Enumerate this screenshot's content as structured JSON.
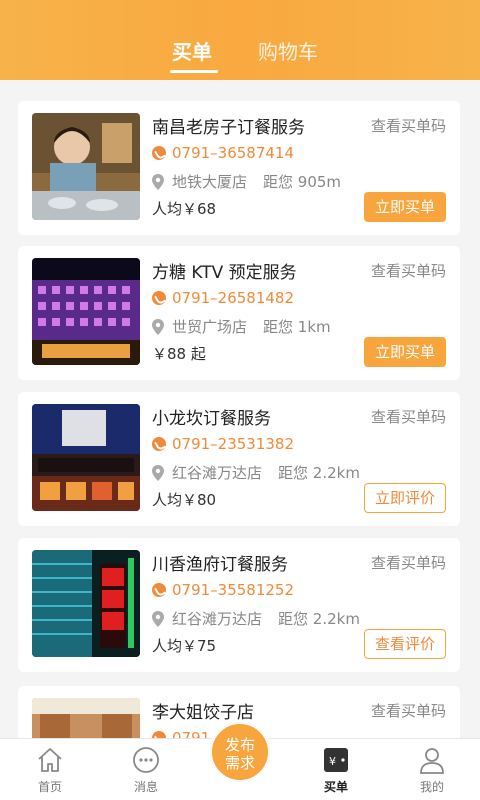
{
  "header": {
    "tabs": [
      {
        "label": "买单",
        "active": true
      },
      {
        "label": "购物车",
        "active": false
      }
    ]
  },
  "orders": [
    {
      "title": "南昌老房子订餐服务",
      "code_link": "查看买单码",
      "phone": "0791–36587414",
      "location": "地铁大厦店",
      "distance": "距您 905m",
      "price": "人均￥68",
      "action": "立即买单",
      "action_style": "filled",
      "thumb": "restaurant-mural"
    },
    {
      "title": "方糖 KTV 预定服务",
      "code_link": "查看买单码",
      "phone": "0791–26581482",
      "location": "世贸广场店",
      "distance": "距您 1km",
      "price": "￥88 起",
      "action": "立即买单",
      "action_style": "filled",
      "thumb": "ktv-night-building"
    },
    {
      "title": "小龙坎订餐服务",
      "code_link": "查看买单码",
      "phone": "0791–23531382",
      "location": "红谷滩万达店",
      "distance": "距您 2.2km",
      "price": "人均￥80",
      "action": "立即评价",
      "action_style": "outline",
      "thumb": "hotpot-storefront"
    },
    {
      "title": "川香渔府订餐服务",
      "code_link": "查看买单码",
      "phone": "0791–35581252",
      "location": "红谷滩万达店",
      "distance": "距您 2.2km",
      "price": "人均￥75",
      "action": "查看评价",
      "action_style": "outline",
      "thumb": "neon-sign-building"
    },
    {
      "title": "李大姐饺子店",
      "code_link": "查看买单码",
      "phone": "0791",
      "location": "",
      "distance": "",
      "price": "",
      "action": "",
      "action_style": "none",
      "thumb": "dumpling-shop"
    }
  ],
  "nav": {
    "items": [
      {
        "label": "首页",
        "icon": "home-icon"
      },
      {
        "label": "消息",
        "icon": "message-icon"
      },
      {
        "label": "买单",
        "icon": "wallet-icon",
        "active": true
      },
      {
        "label": "我的",
        "icon": "user-icon"
      }
    ],
    "publish": {
      "line1": "发布",
      "line2": "需求"
    }
  },
  "colors": {
    "accent": "#f8a53d",
    "phone": "#f08a3a",
    "header": "#f9a93f"
  }
}
